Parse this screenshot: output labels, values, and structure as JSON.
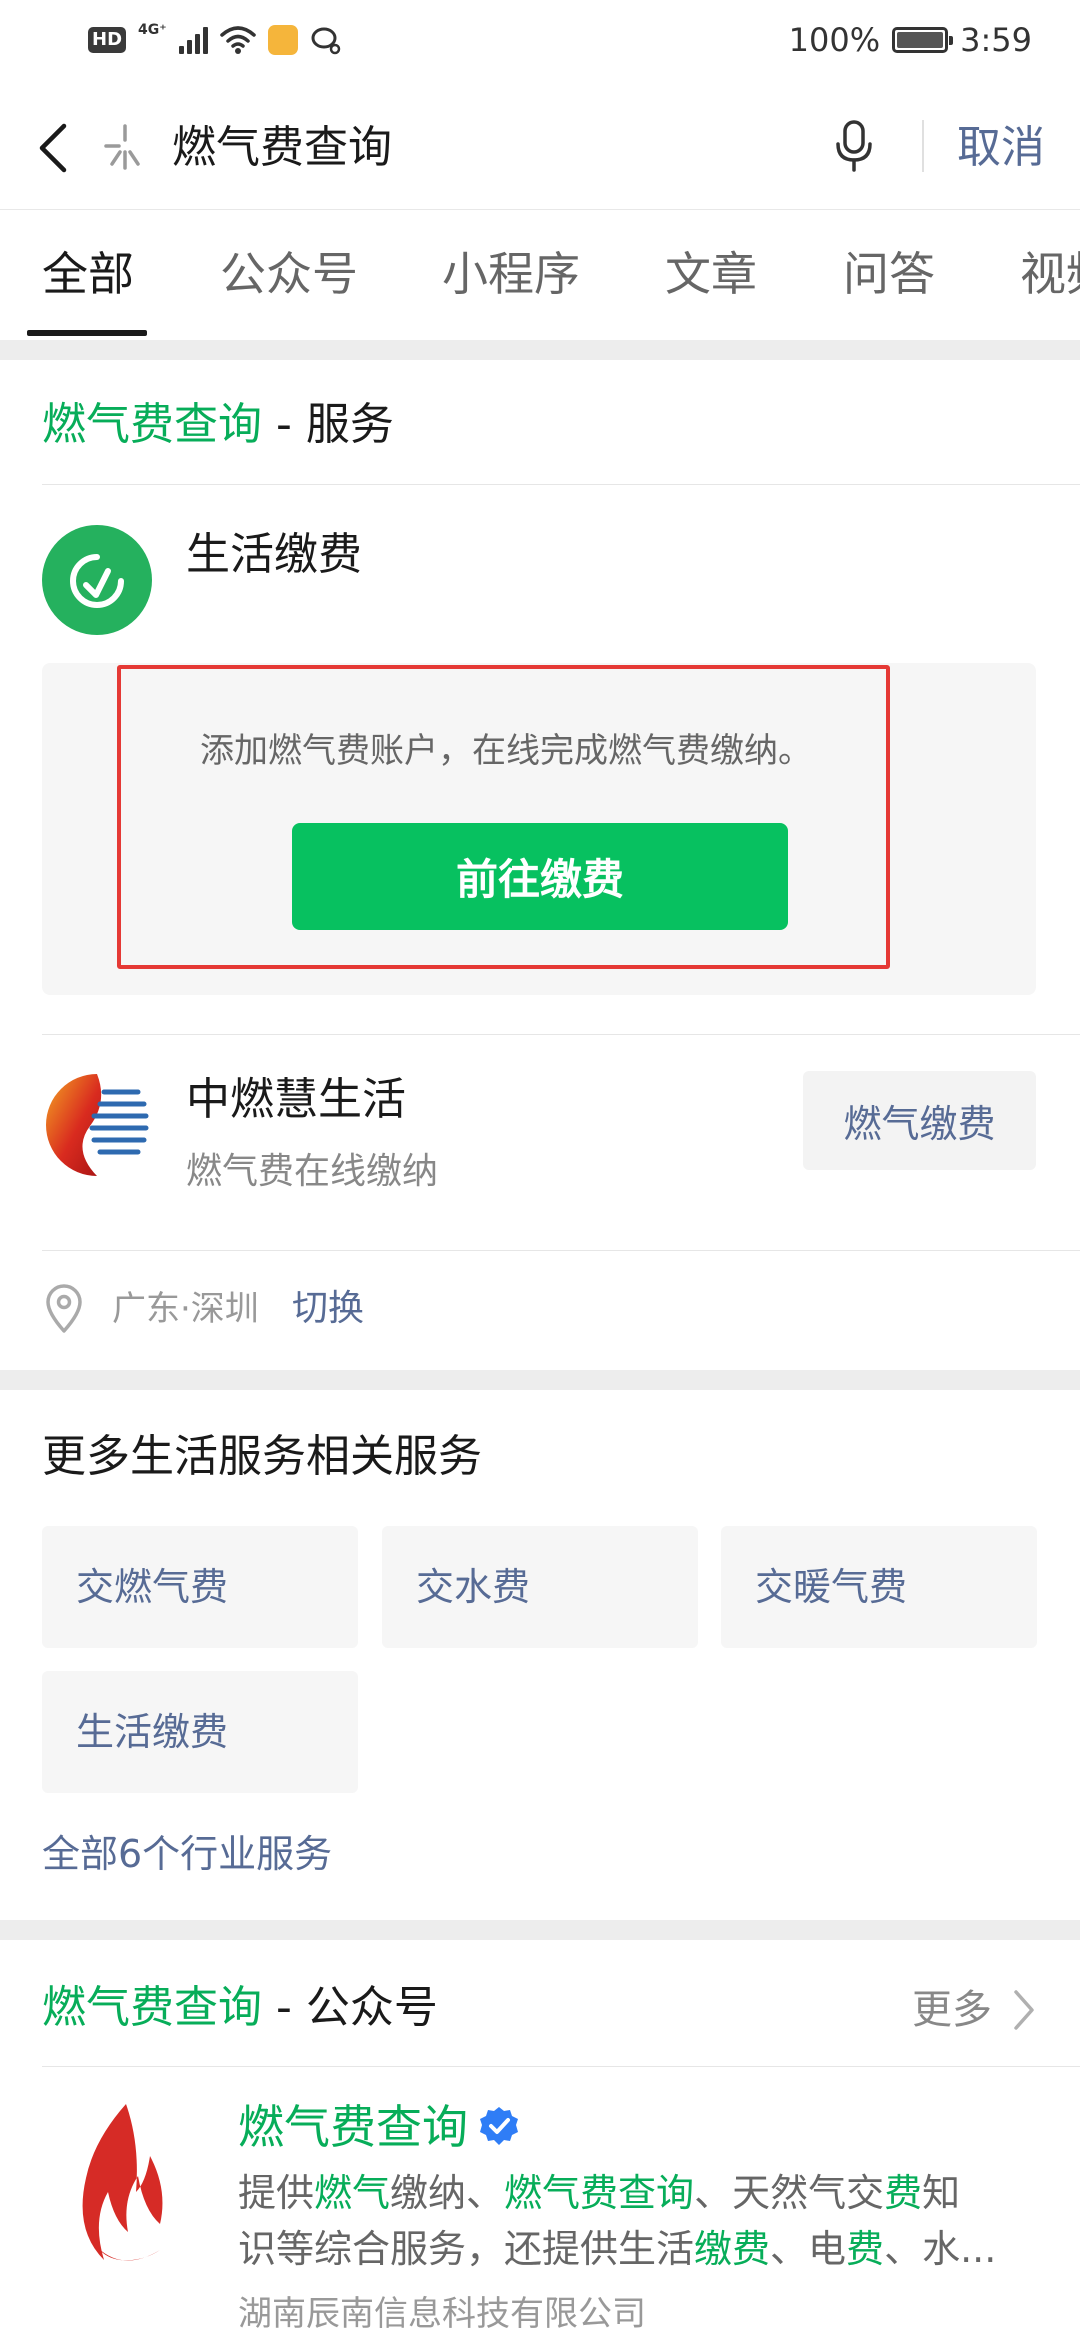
{
  "status_bar": {
    "hd": "HD",
    "network": "4G⁺",
    "battery_percent": "100%",
    "time": "3:59"
  },
  "search": {
    "query": "燃气费查询",
    "cancel": "取消"
  },
  "tabs": [
    {
      "label": "全部",
      "active": true
    },
    {
      "label": "公众号",
      "active": false
    },
    {
      "label": "小程序",
      "active": false
    },
    {
      "label": "文章",
      "active": false
    },
    {
      "label": "问答",
      "active": false
    },
    {
      "label": "视频",
      "active": false
    }
  ],
  "service_section": {
    "title_keyword": "燃气费查询",
    "title_suffix": " - 服务",
    "service_name": "生活缴费",
    "description": "添加燃气费账户，在线完成燃气费缴纳。",
    "pay_button": "前往缴费",
    "second_service": {
      "name": "中燃慧生活",
      "subtitle": "燃气费在线缴纳",
      "action": "燃气缴费"
    },
    "location": {
      "city": "广东·深圳",
      "switch_label": "切换"
    }
  },
  "more_services": {
    "title": "更多生活服务相关服务",
    "items": [
      "交燃气费",
      "交水费",
      "交暖气费",
      "生活缴费"
    ],
    "all_link": "全部6个行业服务"
  },
  "accounts_section": {
    "title_keyword": "燃气费查询",
    "title_suffix": " - 公众号",
    "more": "更多",
    "account": {
      "name": "燃气费查询",
      "desc_line1": [
        {
          "t": "提供",
          "hl": false
        },
        {
          "t": "燃气",
          "hl": true
        },
        {
          "t": "缴纳、",
          "hl": false
        },
        {
          "t": "燃气费查询",
          "hl": true
        },
        {
          "t": "、天然气交",
          "hl": false
        },
        {
          "t": "费",
          "hl": true
        },
        {
          "t": "知",
          "hl": false
        }
      ],
      "desc_line2": [
        {
          "t": "识等综合服务，还提供生活",
          "hl": false
        },
        {
          "t": "缴费",
          "hl": true
        },
        {
          "t": "、电",
          "hl": false
        },
        {
          "t": "费",
          "hl": true
        },
        {
          "t": "、水...",
          "hl": false
        }
      ],
      "company": "湖南辰南信息科技有限公司"
    }
  },
  "colors": {
    "wechat_green": "#07c160",
    "highlight_green": "#07ad59",
    "link_blue": "#576b95",
    "annotation_red": "#e53935"
  }
}
